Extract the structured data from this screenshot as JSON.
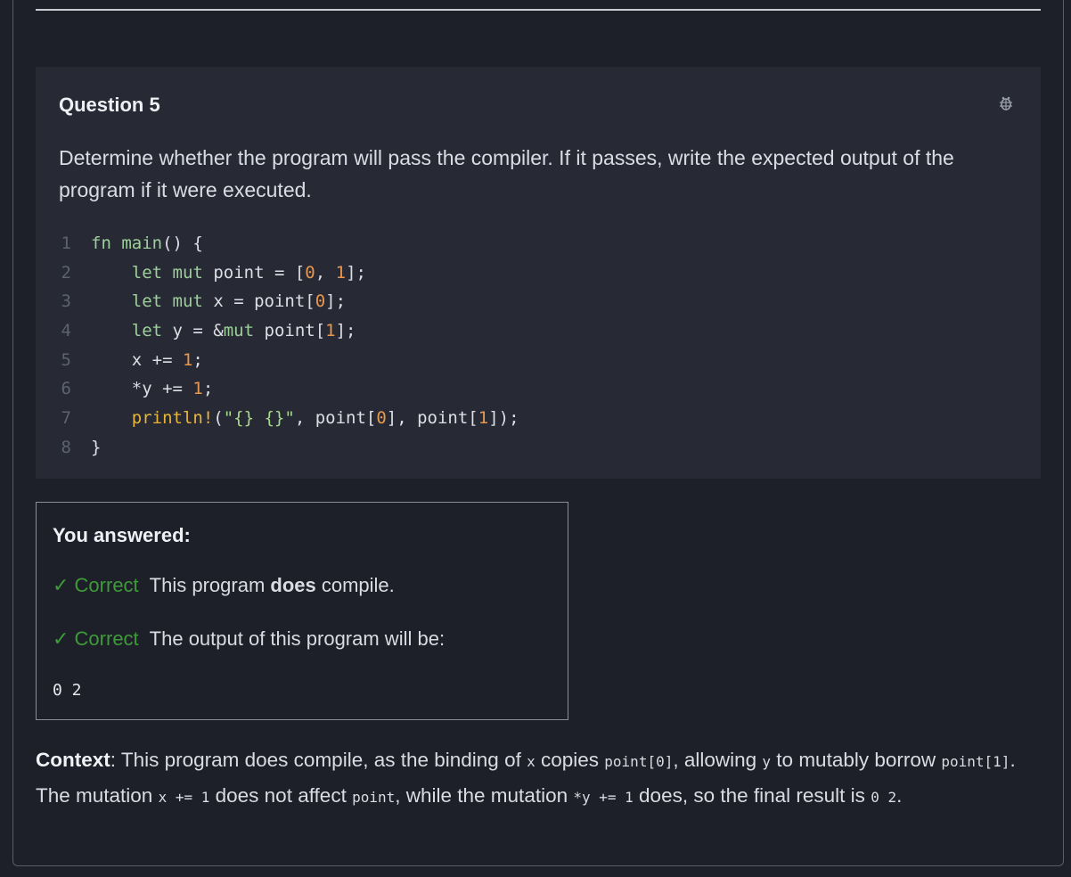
{
  "question": {
    "title": "Question 5",
    "prompt": "Determine whether the program will pass the compiler. If it passes, write the expected output of the program if it were executed.",
    "code_lines": [
      "fn main() {",
      "    let mut point = [0, 1];",
      "    let mut x = point[0];",
      "    let y = &mut point[1];",
      "    x += 1;",
      "    *y += 1;",
      "    println!(\"{} {}\", point[0], point[1]);",
      "}"
    ],
    "line_numbers": [
      "1",
      "2",
      "3",
      "4",
      "5",
      "6",
      "7",
      "8"
    ],
    "icon": "bug-icon"
  },
  "answer": {
    "title": "You answered:",
    "rows": [
      {
        "status": "✓ Correct",
        "pre": "This program ",
        "bold": "does",
        "post": " compile."
      },
      {
        "status": "✓ Correct",
        "pre": "The output of this program will be:"
      }
    ],
    "output": "0 2"
  },
  "context": {
    "label": "Context",
    "t1": ": This program does compile, as the binding of ",
    "c1": "x",
    "t2": " copies ",
    "c2": "point[0]",
    "t3": ", allowing ",
    "c3": "y",
    "t4": " to mutably borrow ",
    "c4": "point[1]",
    "t5": ". The mutation ",
    "c5": "x += 1",
    "t6": " does not affect ",
    "c6": "point",
    "t7": ", while the mutation ",
    "c7": "*y += 1",
    "t8": " does, so the final result is ",
    "c8": "0 2",
    "t9": "."
  },
  "colors": {
    "background": "#1d1f29",
    "card": "#272a35",
    "correct": "#3f9a3a"
  }
}
